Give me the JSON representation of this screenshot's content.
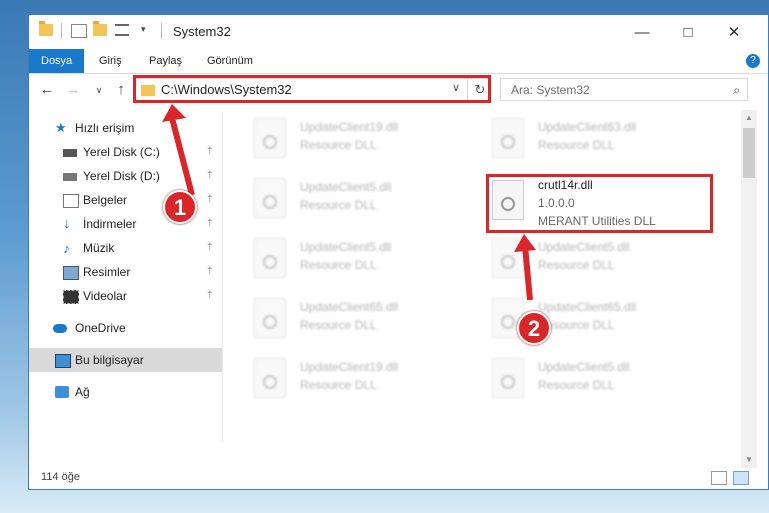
{
  "window": {
    "title": "System32"
  },
  "ribbon": {
    "tabs": [
      "Dosya",
      "Giriş",
      "Paylaş",
      "Görünüm"
    ],
    "help": "?"
  },
  "address": {
    "path": "C:\\Windows\\System32"
  },
  "search": {
    "placeholder": "Ara: System32"
  },
  "sidebar": {
    "items": [
      {
        "label": "Hızlı erişim",
        "icon": "star-icon",
        "pinned": false
      },
      {
        "label": "Yerel Disk (C:)",
        "icon": "drive-icon",
        "pinned": true
      },
      {
        "label": "Yerel Disk (D:)",
        "icon": "drive-icon",
        "pinned": true
      },
      {
        "label": "Belgeler",
        "icon": "documents-icon",
        "pinned": true
      },
      {
        "label": "İndirmeler",
        "icon": "download-icon",
        "pinned": true
      },
      {
        "label": "Müzik",
        "icon": "music-icon",
        "pinned": true
      },
      {
        "label": "Resimler",
        "icon": "pictures-icon",
        "pinned": true
      },
      {
        "label": "Videolar",
        "icon": "video-icon",
        "pinned": true
      },
      {
        "label": "OneDrive",
        "icon": "cloud-icon",
        "pinned": false
      },
      {
        "label": "Bu bilgisayar",
        "icon": "computer-icon",
        "pinned": false
      },
      {
        "label": "Ağ",
        "icon": "network-icon",
        "pinned": false
      }
    ]
  },
  "files": {
    "left": [
      {
        "name": "UpdateClient19.dll",
        "desc": "Resource DLL"
      },
      {
        "name": "UpdateClient5.dll",
        "desc": "Resource DLL"
      },
      {
        "name": "UpdateClient5.dll",
        "desc": "Resource DLL"
      },
      {
        "name": "UpdateClient65.dll",
        "desc": "Resource DLL"
      },
      {
        "name": "UpdateClient19.dll",
        "desc": "Resource DLL"
      }
    ],
    "right": [
      {
        "name": "UpdateClient63.dll",
        "desc": "Resource DLL"
      },
      {
        "name": "crutl14r.dll",
        "version": "1.0.0.0",
        "desc": "MERANT Utilities DLL",
        "highlighted": true
      },
      {
        "name": "UpdateClient5.dll",
        "desc": "Resource DLL"
      },
      {
        "name": "UpdateClient65.dll",
        "desc": "Resource DLL"
      },
      {
        "name": "UpdateClient5.dll",
        "desc": "Resource DLL"
      }
    ]
  },
  "status": {
    "count": "114 öğe"
  },
  "annotations": {
    "step1": "1",
    "step2": "2",
    "color": "#d9262b"
  }
}
